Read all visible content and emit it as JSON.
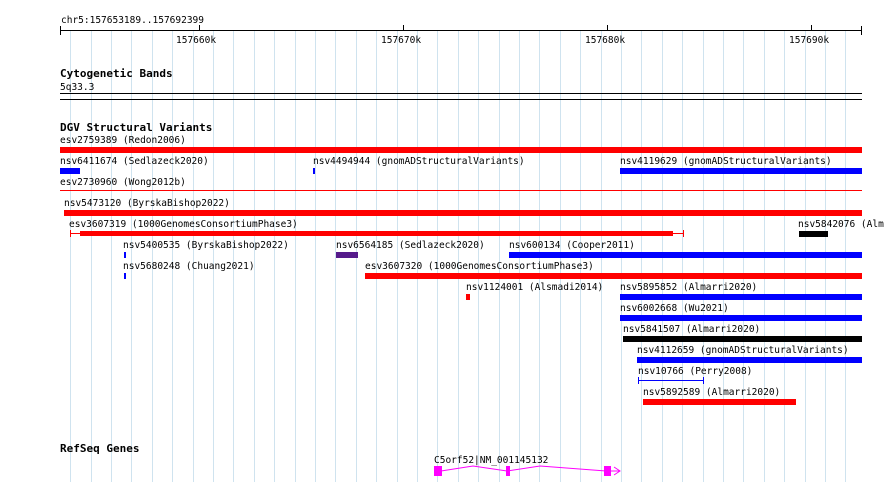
{
  "ruler": {
    "location": "chr5:157653189..157692399",
    "ticks": [
      "157660k",
      "157670k",
      "157680k",
      "157690k"
    ]
  },
  "cytoband": {
    "title": "Cytogenetic Bands",
    "band": "5q33.3"
  },
  "dgv": {
    "title": "DGV Structural Variants",
    "features": [
      {
        "label": "esv2759389 (Redon2006)",
        "color": "#ff0000"
      },
      {
        "label": "nsv6411674 (Sedlazeck2020)",
        "color": "#0000ff"
      },
      {
        "label": "nsv4494944 (gnomADStructuralVariants)",
        "color": "#0000ff"
      },
      {
        "label": "nsv4119629 (gnomADStructuralVariants)",
        "color": "#0000ff"
      },
      {
        "label": "esv2730960 (Wong2012b)",
        "color": "#ff0000"
      },
      {
        "label": "nsv5473120 (ByrskaBishop2022)",
        "color": "#ff0000"
      },
      {
        "label": "esv3607319 (1000GenomesConsortiumPhase3)",
        "color": "#ff0000"
      },
      {
        "label": "nsv5842076 (Alm",
        "color": "#000000"
      },
      {
        "label": "nsv5400535 (ByrskaBishop2022)",
        "color": "#0000ff"
      },
      {
        "label": "nsv6564185 (Sedlazeck2020)",
        "color": "#551a8b"
      },
      {
        "label": "nsv600134 (Cooper2011)",
        "color": "#0000ff"
      },
      {
        "label": "nsv5680248 (Chuang2021)",
        "color": "#0000ff"
      },
      {
        "label": "esv3607320 (1000GenomesConsortiumPhase3)",
        "color": "#ff0000"
      },
      {
        "label": "nsv1124001 (Alsmadi2014)",
        "color": "#ff0000"
      },
      {
        "label": "nsv5895852 (Almarri2020)",
        "color": "#0000ff"
      },
      {
        "label": "nsv6002668 (Wu2021)",
        "color": "#0000ff"
      },
      {
        "label": "nsv5841507 (Almarri2020)",
        "color": "#000000"
      },
      {
        "label": "nsv4112659 (gnomADStructuralVariants)",
        "color": "#0000ff"
      },
      {
        "label": "nsv10766 (Perry2008)",
        "color": "#0000ff"
      },
      {
        "label": "nsv5892589 (Almarri2020)",
        "color": "#ff0000"
      }
    ]
  },
  "refseq": {
    "title": "RefSeq Genes",
    "gene": "C5orf52|NM_001145132",
    "color": "#ff00ff"
  }
}
